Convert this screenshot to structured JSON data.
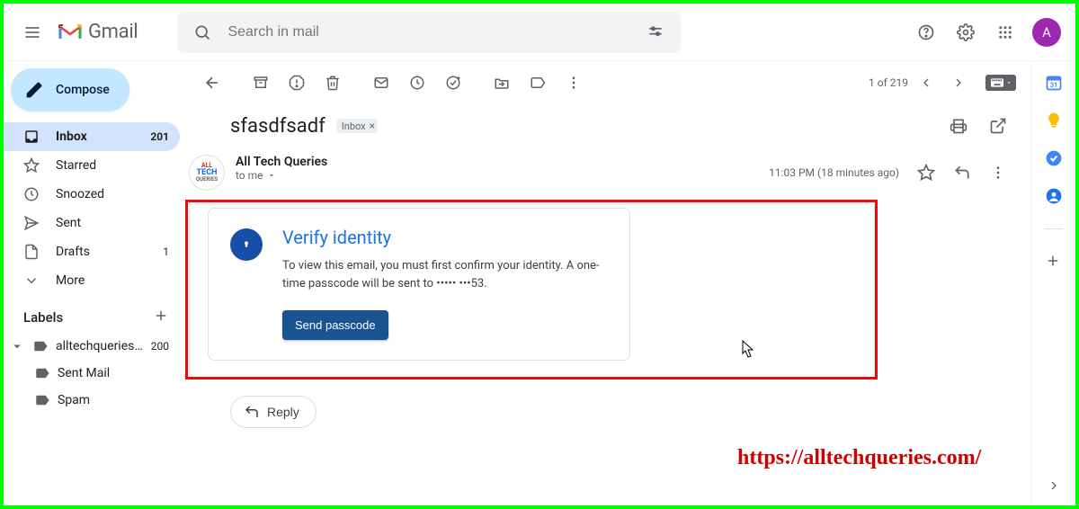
{
  "app": {
    "name": "Gmail"
  },
  "search": {
    "placeholder": "Search in mail"
  },
  "header": {
    "avatar_initial": "A"
  },
  "compose": {
    "label": "Compose"
  },
  "nav": {
    "inbox": {
      "label": "Inbox",
      "count": "201"
    },
    "starred": {
      "label": "Starred"
    },
    "snoozed": {
      "label": "Snoozed"
    },
    "sent": {
      "label": "Sent"
    },
    "drafts": {
      "label": "Drafts",
      "count": "1"
    },
    "more": {
      "label": "More"
    }
  },
  "labels": {
    "heading": "Labels",
    "items": [
      {
        "label": "alltechqueries@...",
        "count": "200"
      },
      {
        "label": "Sent Mail"
      },
      {
        "label": "Spam"
      }
    ]
  },
  "pager": {
    "text": "1 of 219"
  },
  "message": {
    "subject": "sfasdfsadf",
    "chip": "Inbox",
    "sender": "All Tech Queries",
    "recipient": "to me",
    "timestamp": "11:03 PM (18 minutes ago)",
    "verify": {
      "title": "Verify identity",
      "body": "To view this email, you must first confirm your identity. A one-time passcode will be sent to ••••• •••53.",
      "button": "Send passcode"
    },
    "reply": "Reply"
  },
  "watermark": "https://alltechqueries.com/"
}
